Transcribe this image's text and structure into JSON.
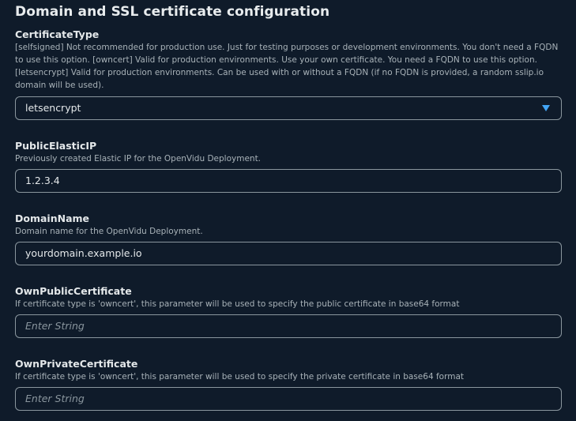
{
  "section": {
    "title": "Domain and SSL certificate configuration"
  },
  "fields": {
    "certificate_type": {
      "label": "CertificateType",
      "description": "[selfsigned] Not recommended for production use. Just for testing purposes or development environments. You don't need a FQDN to use this option. [owncert] Valid for production environments. Use your own certificate. You need a FQDN to use this option. [letsencrypt] Valid for production environments. Can be used with or without a FQDN (if no FQDN is provided, a random sslip.io domain will be used).",
      "value": "letsencrypt",
      "icon": "caret-down-icon"
    },
    "public_elastic_ip": {
      "label": "PublicElasticIP",
      "description": "Previously created Elastic IP for the OpenVidu Deployment.",
      "value": "1.2.3.4"
    },
    "domain_name": {
      "label": "DomainName",
      "description": "Domain name for the OpenVidu Deployment.",
      "value": "yourdomain.example.io"
    },
    "own_public_certificate": {
      "label": "OwnPublicCertificate",
      "description": "If certificate type is 'owncert', this parameter will be used to specify the public certificate in base64 format",
      "placeholder": "Enter String"
    },
    "own_private_certificate": {
      "label": "OwnPrivateCertificate",
      "description": "If certificate type is 'owncert', this parameter will be used to specify the private certificate in base64 format",
      "placeholder": "Enter String"
    }
  },
  "colors": {
    "background": "#0f1b2a",
    "border": "#8a969e",
    "accent": "#42a5f5"
  }
}
